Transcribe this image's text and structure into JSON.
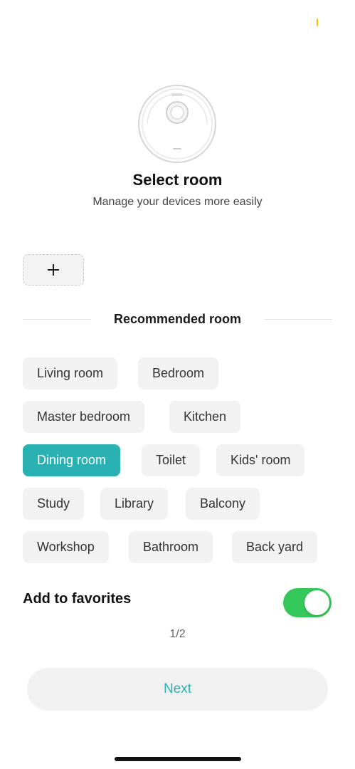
{
  "header": {
    "title": "Select room",
    "subtitle": "Manage your devices more easily",
    "device_image_icon": "robot-vacuum-icon"
  },
  "add_room": {
    "icon": "plus-icon"
  },
  "recommended": {
    "label": "Recommended room",
    "selected_room": "Dining room",
    "rooms": [
      "Living room",
      "Bedroom",
      "Master bedroom",
      "Kitchen",
      "Dining room",
      "Toilet",
      "Kids' room",
      "Study",
      "Library",
      "Balcony",
      "Workshop",
      "Bathroom",
      "Back yard"
    ]
  },
  "favorites": {
    "label": "Add to favorites",
    "enabled": true
  },
  "pager": {
    "text": "1/2"
  },
  "footer": {
    "next_label": "Next"
  },
  "colors": {
    "accent": "#2ab1b1",
    "toggle_on": "#34c759",
    "chip_bg": "#f2f2f2"
  }
}
